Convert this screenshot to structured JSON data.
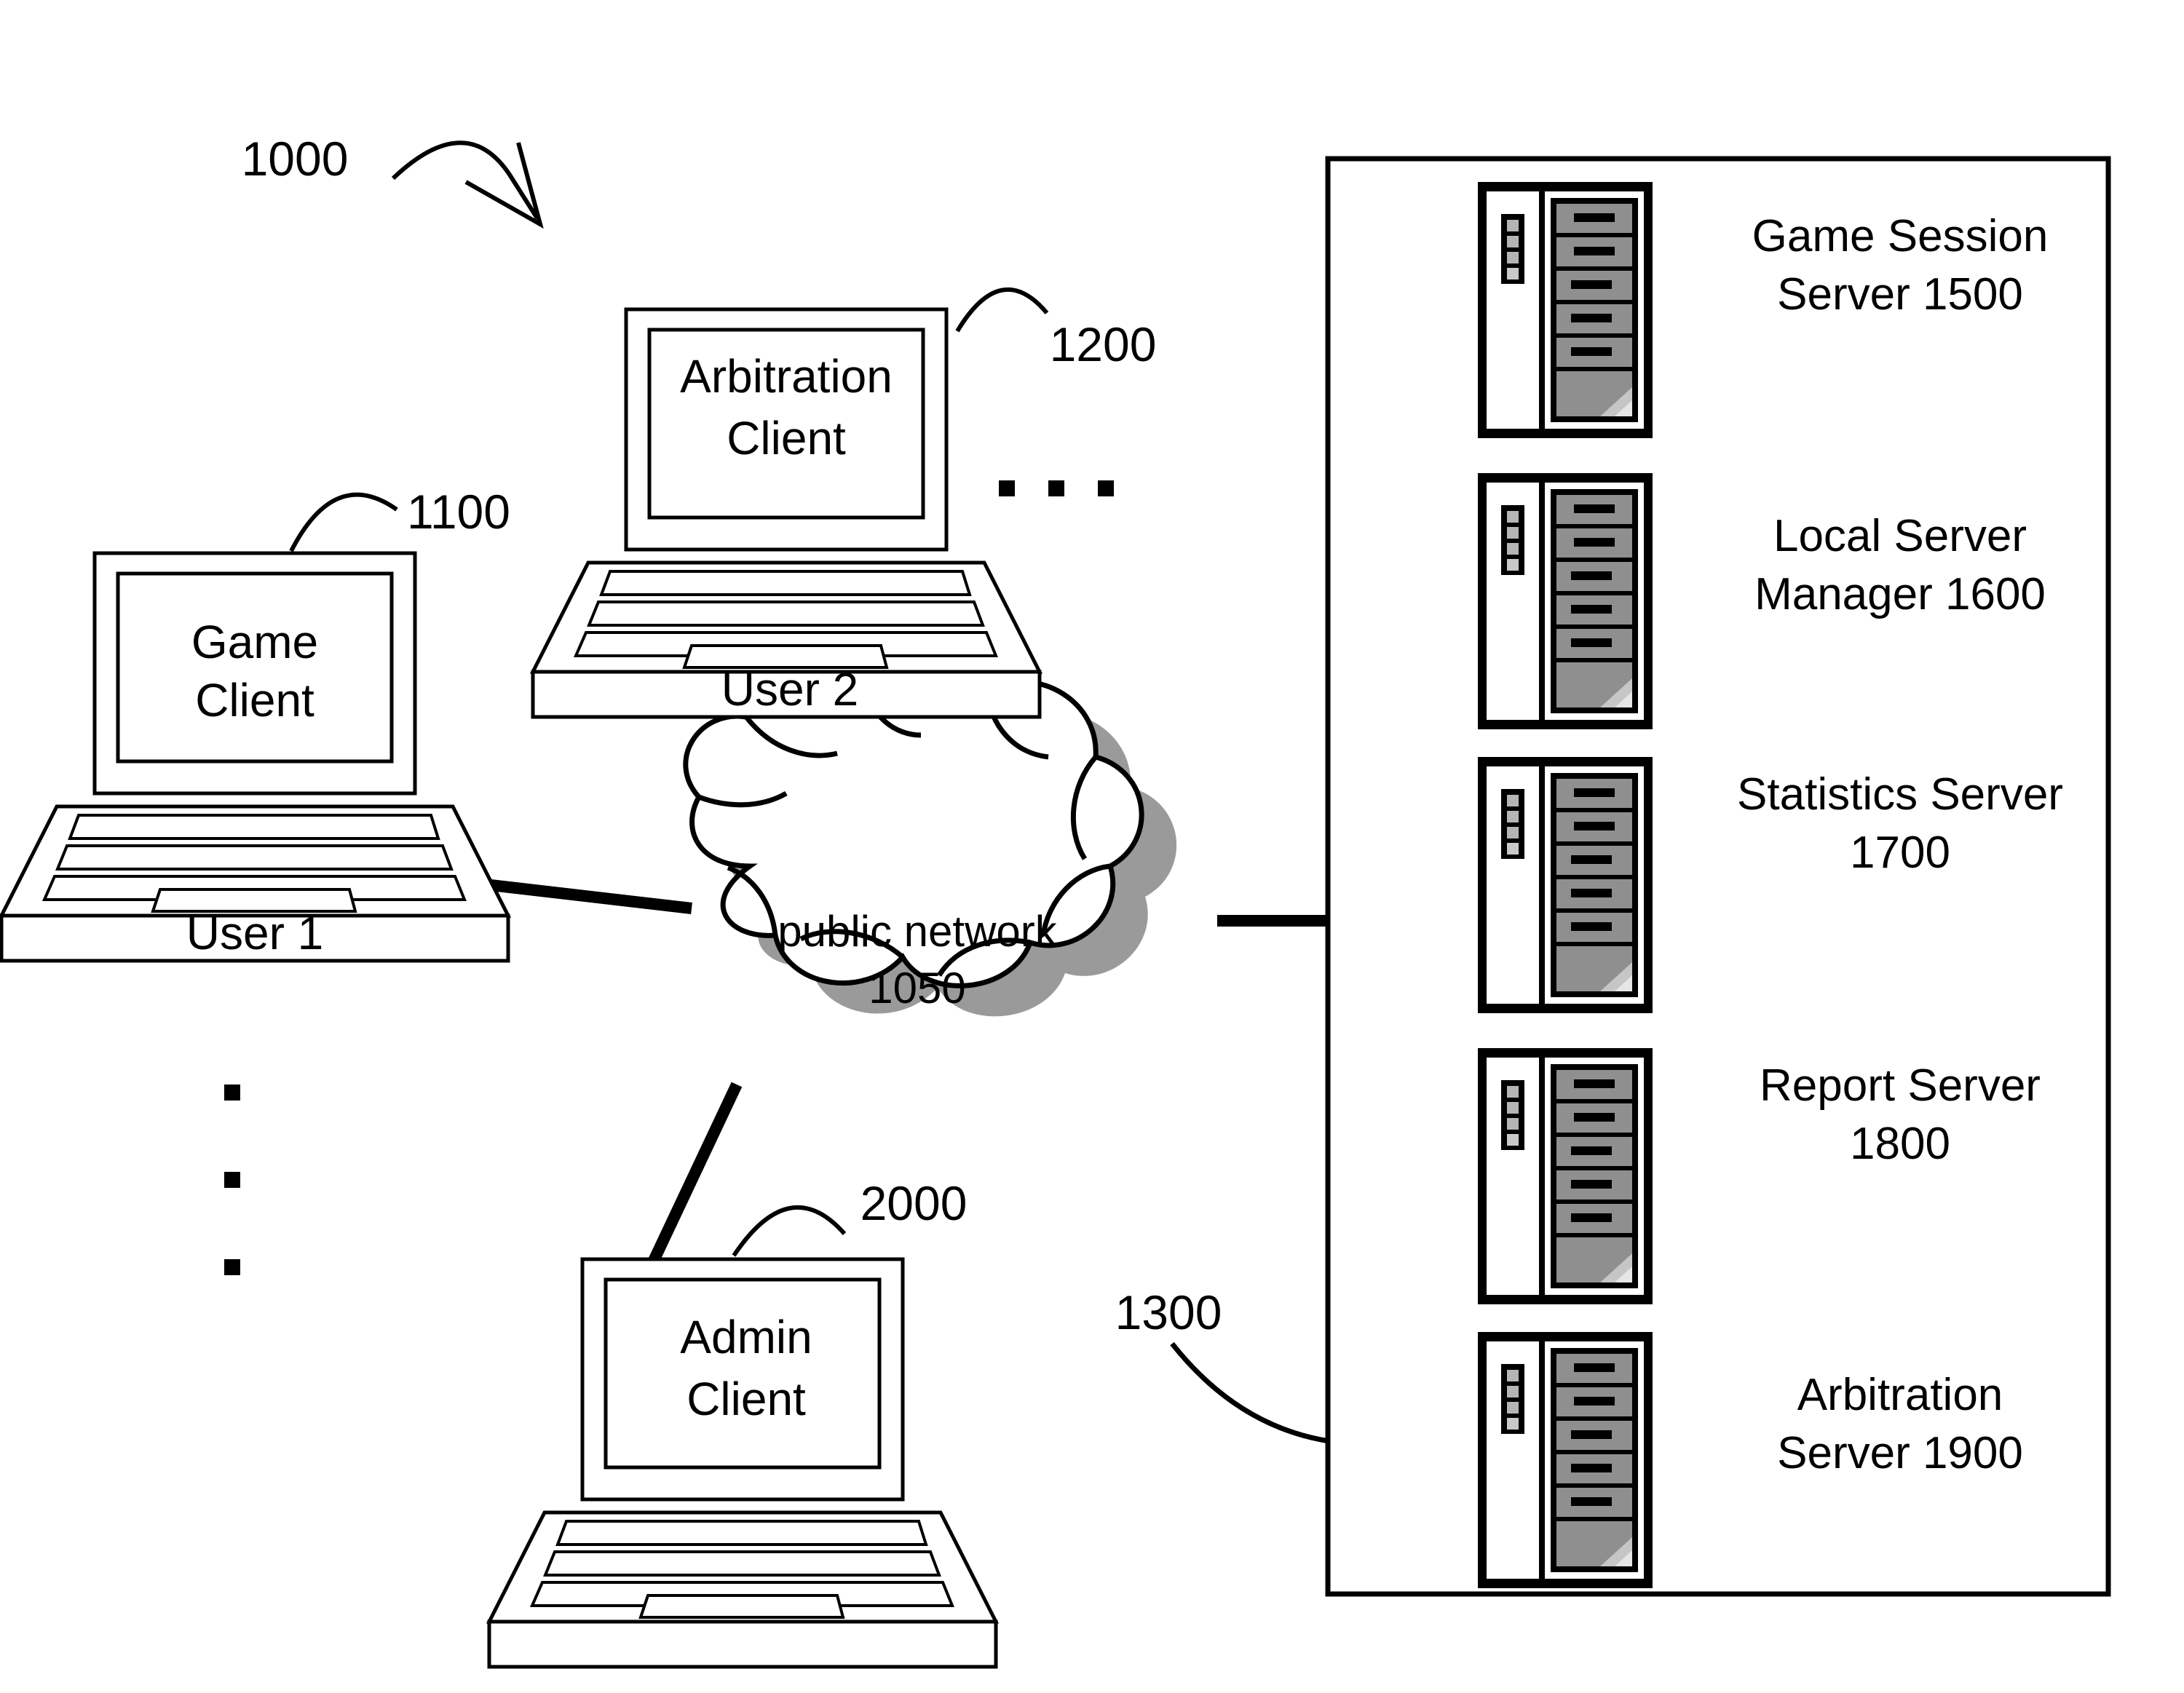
{
  "figure": {
    "reference_numeral": "1000"
  },
  "clients": [
    {
      "id": "game-client",
      "screen_line1": "Game",
      "screen_line2": "Client",
      "ref": "1100",
      "user_label": "User 1"
    },
    {
      "id": "arbitration-client",
      "screen_line1": "Arbitration",
      "screen_line2": "Client",
      "ref": "1200",
      "user_label": "User 2"
    },
    {
      "id": "admin-client",
      "screen_line1": "Admin",
      "screen_line2": "Client",
      "ref": "2000",
      "user_label": ""
    }
  ],
  "network": {
    "name": "public network",
    "ref": "1050"
  },
  "server_group": {
    "ref": "1300",
    "servers": [
      {
        "line1": "Game Session",
        "line2": "Server 1500",
        "ref": "1500"
      },
      {
        "line1": "Local Server",
        "line2": "Manager 1600",
        "ref": "1600"
      },
      {
        "line1": "Statistics Server",
        "line2": "1700",
        "ref": "1700"
      },
      {
        "line1": "Report Server",
        "line2": "1800",
        "ref": "1800"
      },
      {
        "line1": "Arbitration",
        "line2": "Server 1900",
        "ref": "1900"
      }
    ]
  },
  "ellipses": {
    "horizontal_more_clients": "· · ·",
    "vertical_more_users": "·"
  },
  "colors": {
    "stroke": "#000000",
    "background": "#ffffff",
    "server_unit_fill": "#8f8f8f",
    "server_unit_fill_light": "#a8a8a8",
    "cloud_shadow": "#9a9a9a"
  }
}
